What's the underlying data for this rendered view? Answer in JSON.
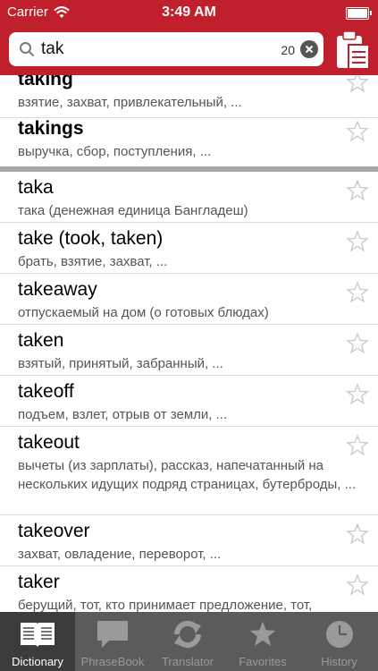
{
  "status_bar": {
    "carrier": "Carrier",
    "time": "3:49 AM"
  },
  "search": {
    "query": "tak",
    "count": "20"
  },
  "entries": [
    {
      "word": "taking",
      "translation": "взятие, захват, привлекательный, ...",
      "bold": true
    },
    {
      "word": "takings",
      "translation": "выручка, сбор, поступления, ...",
      "bold": true
    },
    {
      "word": "taka",
      "translation": "така (денежная единица Бангладеш)",
      "bold": false
    },
    {
      "word": "take (took, taken)",
      "translation": "брать, взятие, захват, ...",
      "bold": false
    },
    {
      "word": "takeaway",
      "translation": "отпускаемый на дом (о готовых блюдах)",
      "bold": false
    },
    {
      "word": "taken",
      "translation": "взятый, принятый, забранный, ...",
      "bold": false
    },
    {
      "word": "takeoff",
      "translation": "подъем, взлет, отрыв от земли, ...",
      "bold": false
    },
    {
      "word": "takeout",
      "translation": "вычеты (из зарплаты), рассказ, напечатанный на нескольких идущих подряд страницах, бутерброды, ...",
      "bold": false
    },
    {
      "word": "takeover",
      "translation": "захват, овладение, переворот, ...",
      "bold": false
    },
    {
      "word": "taker",
      "translation": "берущий, тот, кто принимает предложение, тот,",
      "bold": false
    }
  ],
  "tabs": [
    {
      "label": "Dictionary",
      "active": true
    },
    {
      "label": "PhraseBook",
      "active": false
    },
    {
      "label": "Translator",
      "active": false
    },
    {
      "label": "Favorites",
      "active": false
    },
    {
      "label": "History",
      "active": false
    }
  ],
  "colors": {
    "header_red": "#c0202b",
    "tabbar_gray": "#5b5b5b",
    "tab_active": "#3c3c3c"
  }
}
